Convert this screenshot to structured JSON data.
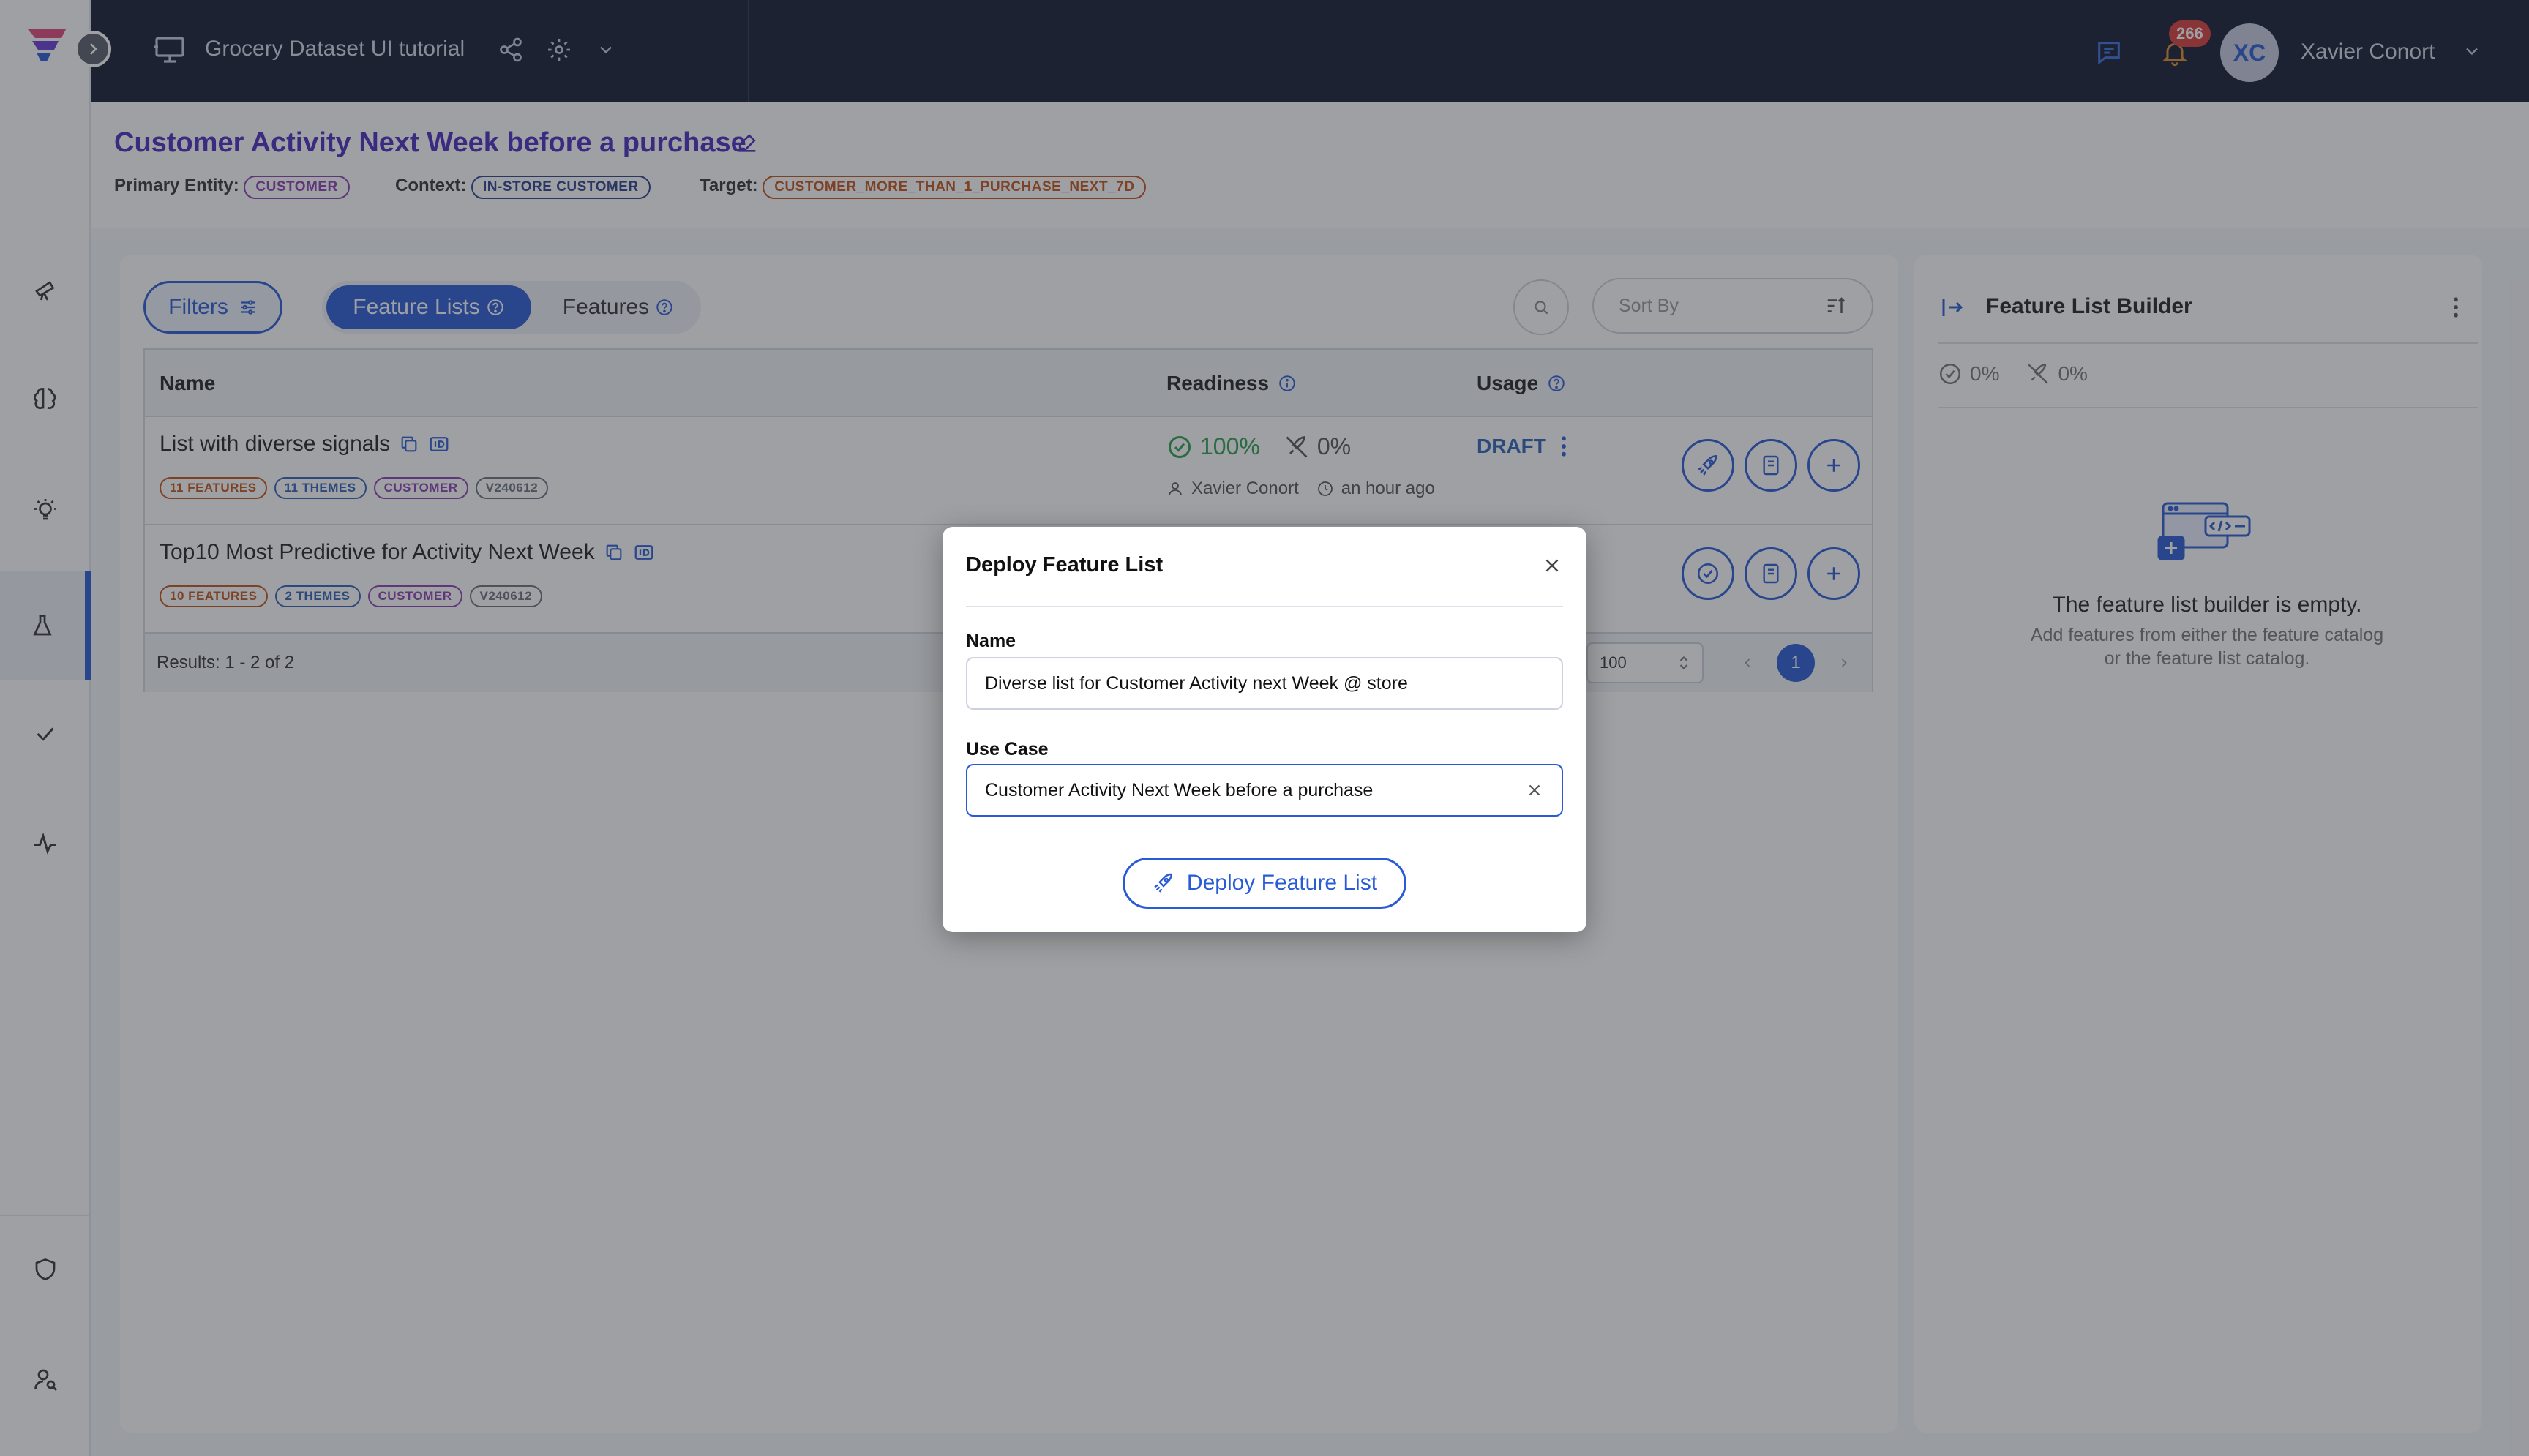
{
  "topbar": {
    "project_title": "Grocery Dataset UI tutorial",
    "notification_count": "266",
    "user_initials": "XC",
    "user_name": "Xavier Conort"
  },
  "use_case": {
    "title": "Customer Activity Next Week before a purchase",
    "primary_entity_label": "Primary Entity:",
    "primary_entity": "CUSTOMER",
    "context_label": "Context:",
    "context": "IN-STORE CUSTOMER",
    "target_label": "Target:",
    "target": "CUSTOMER_MORE_THAN_1_PURCHASE_NEXT_7D"
  },
  "toolbar": {
    "filters_label": "Filters",
    "tab_feature_lists": "Feature Lists",
    "tab_features": "Features",
    "sort_placeholder": "Sort By"
  },
  "table": {
    "headers": {
      "name": "Name",
      "readiness": "Readiness",
      "usage": "Usage"
    },
    "rows": [
      {
        "name": "List with diverse signals",
        "tags": [
          "11 FEATURES",
          "11 THEMES",
          "CUSTOMER",
          "V240612"
        ],
        "readiness": "100%",
        "online": "0%",
        "author": "Xavier Conort",
        "updated": "an hour ago",
        "status": "DRAFT"
      },
      {
        "name": "Top10 Most Predictive for Activity Next Week",
        "tags": [
          "10 FEATURES",
          "2 THEMES",
          "CUSTOMER",
          "V240612"
        ]
      }
    ],
    "results": "Results: 1 - 2 of 2",
    "page_size": "100",
    "current_page": "1"
  },
  "builder": {
    "title": "Feature List Builder",
    "readiness": "0%",
    "online": "0%",
    "empty_title": "The feature list builder is empty.",
    "empty_line1": "Add features from either the feature catalog",
    "empty_line2": "or the feature list catalog."
  },
  "modal": {
    "title": "Deploy Feature List",
    "name_label": "Name",
    "name_value": "Diverse list for Customer Activity next Week @ store",
    "use_case_label": "Use Case",
    "use_case_value": "Customer Activity Next Week before a purchase",
    "deploy_label": "Deploy Feature List"
  },
  "icons": {
    "sidebar": [
      "telescope-icon",
      "brain-icon",
      "lightbulb-icon",
      "flask-icon",
      "check-icon",
      "activity-icon",
      "shield-icon",
      "user-search-icon"
    ]
  },
  "colors": {
    "accent": "#2a5bd7",
    "topbar_bg": "#141a33",
    "ready_green": "#2e9e4f",
    "title_purple": "#4b2bbf"
  }
}
